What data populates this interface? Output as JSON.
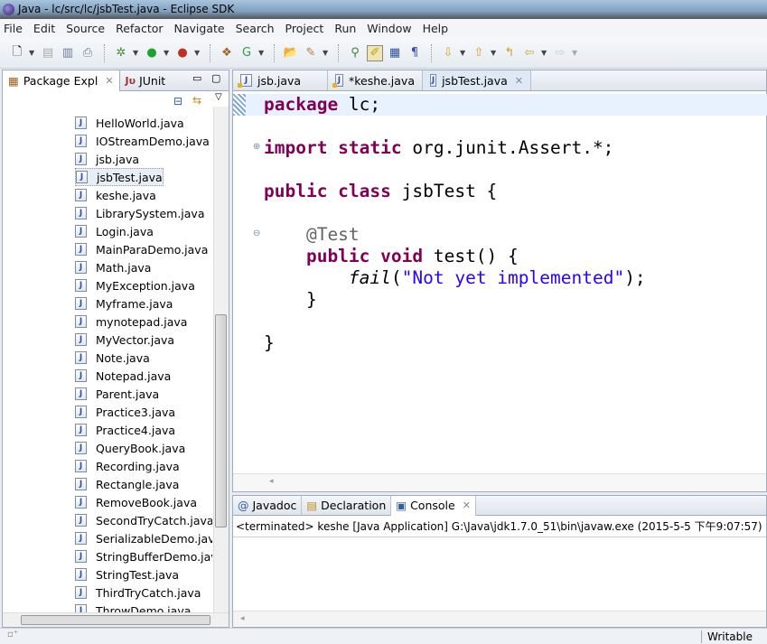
{
  "window": {
    "title": "Java - lc/src/lc/jsbTest.java - Eclipse SDK"
  },
  "menu": [
    "File",
    "Edit",
    "Source",
    "Refactor",
    "Navigate",
    "Search",
    "Project",
    "Run",
    "Window",
    "Help"
  ],
  "left_panel": {
    "tabs": [
      {
        "label": "Package Expl"
      },
      {
        "label": "JUnit"
      }
    ],
    "files": [
      "HelloWorld.java",
      "IOStreamDemo.java",
      "jsb.java",
      "jsbTest.java",
      "keshe.java",
      "LibrarySystem.java",
      "Login.java",
      "MainParaDemo.java",
      "Math.java",
      "MyException.java",
      "Myframe.java",
      "mynotepad.java",
      "MyVector.java",
      "Note.java",
      "Notepad.java",
      "Parent.java",
      "Practice3.java",
      "Practice4.java",
      "QueryBook.java",
      "Recording.java",
      "Rectangle.java",
      "RemoveBook.java",
      "SecondTryCatch.java",
      "SerializableDemo.java",
      "StringBufferDemo.java",
      "StringTest.java",
      "ThirdTryCatch.java",
      "ThrowDemo.java"
    ],
    "selected": "jsbTest.java"
  },
  "editor": {
    "tabs": [
      {
        "label": "jsb.java"
      },
      {
        "label": "*keshe.java"
      },
      {
        "label": "jsbTest.java"
      }
    ],
    "code": {
      "l1_kw": "package",
      "l1_rest": " lc;",
      "l3_kw": "import static",
      "l3_rest": " org.junit.Assert.*;",
      "l5_kw": "public class",
      "l5_rest": " jsbTest {",
      "l7": "    @Test",
      "l8_kw": "    public void",
      "l8_rest": " test() {",
      "l9_fn": "fail",
      "l9_str": "\"Not yet implemented\"",
      "l9_end": ");",
      "l10": "    }",
      "l12": "}"
    }
  },
  "bottom_panel": {
    "tabs": [
      {
        "label": "Javadoc"
      },
      {
        "label": "Declaration"
      },
      {
        "label": "Console"
      }
    ],
    "console_header": "<terminated> keshe [Java Application] G:\\Java\\jdk1.7.0_51\\bin\\javaw.exe (2015-5-5 下午9:07:57)"
  },
  "status": {
    "mode": "Writable"
  }
}
